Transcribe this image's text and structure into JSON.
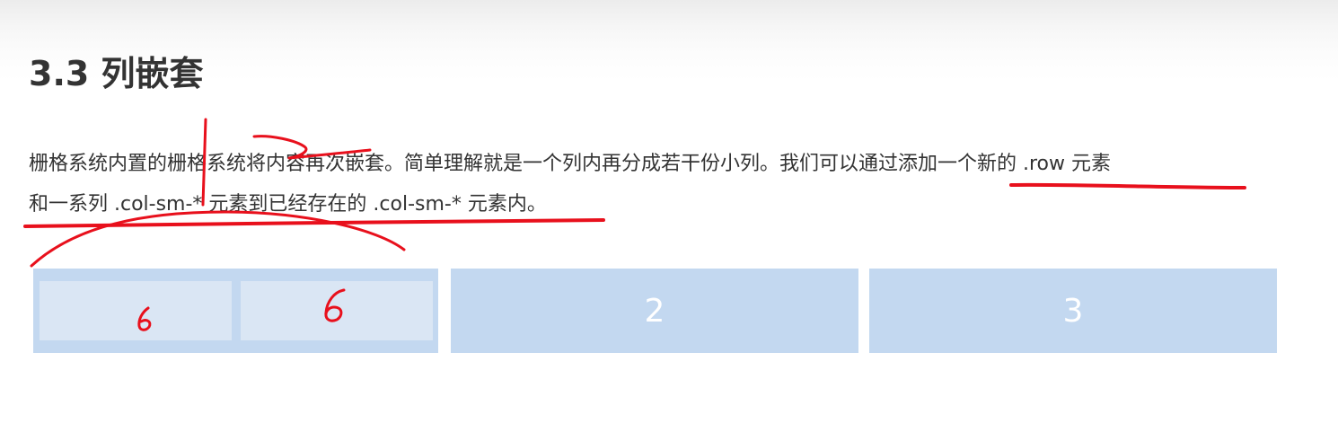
{
  "section": {
    "title": "3.3 列嵌套"
  },
  "paragraph": {
    "line1": "栅格系统内置的栅格系统将内容再次嵌套。简单理解就是一个列内再分成若干份小列。我们可以通过添加一个新的 .row 元素",
    "line2": "和一系列 .col-sm-* 元素到已经存在的 .col-sm-* 元素内。"
  },
  "grid": {
    "columns": [
      {
        "label": "",
        "nested": [
          {
            "label": ""
          },
          {
            "label": ""
          }
        ]
      },
      {
        "label": "2"
      },
      {
        "label": "3"
      }
    ]
  },
  "annotations": {
    "handwritten_labels": [
      "6",
      "6"
    ],
    "color": "#e8101c"
  },
  "colors": {
    "column_bg": "#c3d8f0",
    "nested_column_bg": "#dae6f4",
    "text": "#333333",
    "column_label": "#ffffff"
  }
}
